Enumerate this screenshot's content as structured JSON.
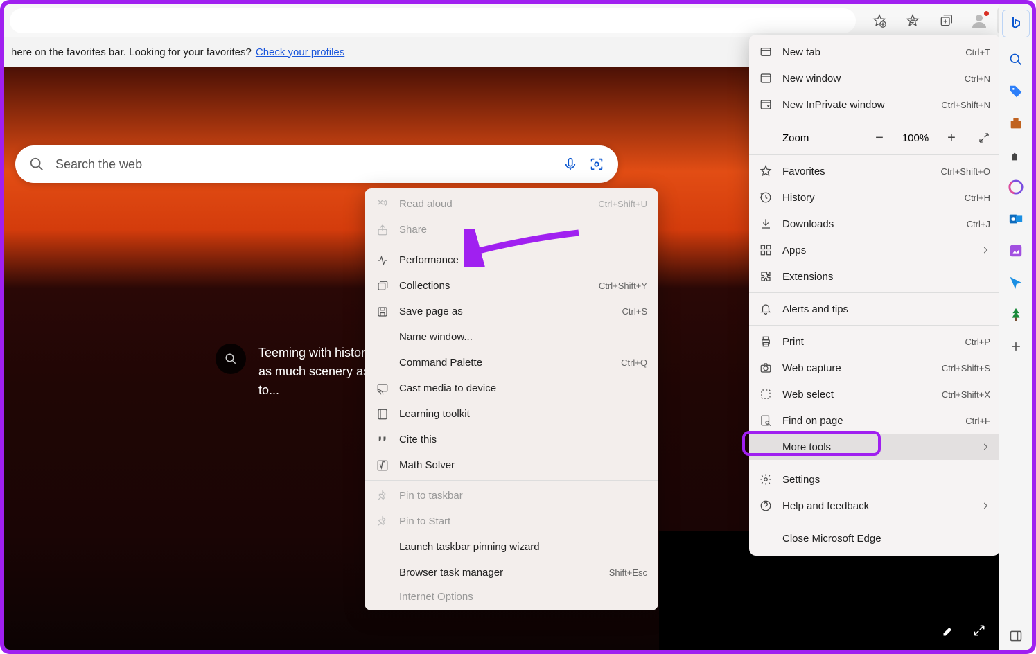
{
  "favbar": {
    "text": "here on the favorites bar. Looking for your favorites?",
    "link": "Check your profiles"
  },
  "search": {
    "placeholder": "Search the web"
  },
  "caption": {
    "line1": "Teeming with history",
    "line2": "as much scenery as in",
    "line3": "to..."
  },
  "main_menu": {
    "new_tab": {
      "label": "New tab",
      "shortcut": "Ctrl+T"
    },
    "new_window": {
      "label": "New window",
      "shortcut": "Ctrl+N"
    },
    "new_inprivate": {
      "label": "New InPrivate window",
      "shortcut": "Ctrl+Shift+N"
    },
    "zoom": {
      "label": "Zoom",
      "value": "100%"
    },
    "favorites": {
      "label": "Favorites",
      "shortcut": "Ctrl+Shift+O"
    },
    "history": {
      "label": "History",
      "shortcut": "Ctrl+H"
    },
    "downloads": {
      "label": "Downloads",
      "shortcut": "Ctrl+J"
    },
    "apps": {
      "label": "Apps"
    },
    "extensions": {
      "label": "Extensions"
    },
    "alerts": {
      "label": "Alerts and tips"
    },
    "print": {
      "label": "Print",
      "shortcut": "Ctrl+P"
    },
    "web_capture": {
      "label": "Web capture",
      "shortcut": "Ctrl+Shift+S"
    },
    "web_select": {
      "label": "Web select",
      "shortcut": "Ctrl+Shift+X"
    },
    "find": {
      "label": "Find on page",
      "shortcut": "Ctrl+F"
    },
    "more_tools": {
      "label": "More tools"
    },
    "settings": {
      "label": "Settings"
    },
    "help": {
      "label": "Help and feedback"
    },
    "close": {
      "label": "Close Microsoft Edge"
    }
  },
  "sub_menu": {
    "read_aloud": {
      "label": "Read aloud",
      "shortcut": "Ctrl+Shift+U"
    },
    "share": {
      "label": "Share"
    },
    "performance": {
      "label": "Performance"
    },
    "collections": {
      "label": "Collections",
      "shortcut": "Ctrl+Shift+Y"
    },
    "save_page": {
      "label": "Save page as",
      "shortcut": "Ctrl+S"
    },
    "name_window": {
      "label": "Name window..."
    },
    "command_palette": {
      "label": "Command Palette",
      "shortcut": "Ctrl+Q"
    },
    "cast_media": {
      "label": "Cast media to device"
    },
    "learning": {
      "label": "Learning toolkit"
    },
    "cite": {
      "label": "Cite this"
    },
    "math": {
      "label": "Math Solver"
    },
    "pin_taskbar": {
      "label": "Pin to taskbar"
    },
    "pin_start": {
      "label": "Pin to Start"
    },
    "launch_pin": {
      "label": "Launch taskbar pinning wizard"
    },
    "task_manager": {
      "label": "Browser task manager",
      "shortcut": "Shift+Esc"
    },
    "internet_options": {
      "label": "Internet Options"
    }
  }
}
